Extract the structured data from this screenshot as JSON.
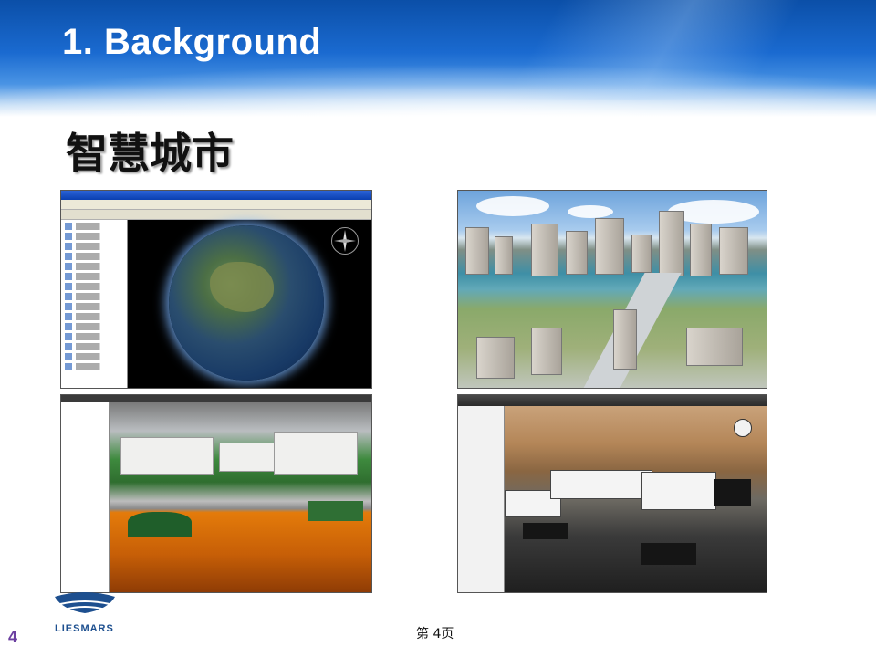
{
  "slide": {
    "title": "1. Background",
    "subtitle": "智慧城市",
    "page_number": "4",
    "footer": "第 4页",
    "logo_text": "LIESMARS"
  },
  "images": [
    {
      "name": "globe-software-screenshot"
    },
    {
      "name": "3d-city-aerial-render"
    },
    {
      "name": "campus-underground-3d-screenshot"
    },
    {
      "name": "indoor-3d-model-screenshot"
    }
  ],
  "colors": {
    "header_blue": "#1a6ad0",
    "title_white": "#ffffff",
    "page_number_purple": "#6b3fa0",
    "logo_blue": "#1d4f8f"
  }
}
